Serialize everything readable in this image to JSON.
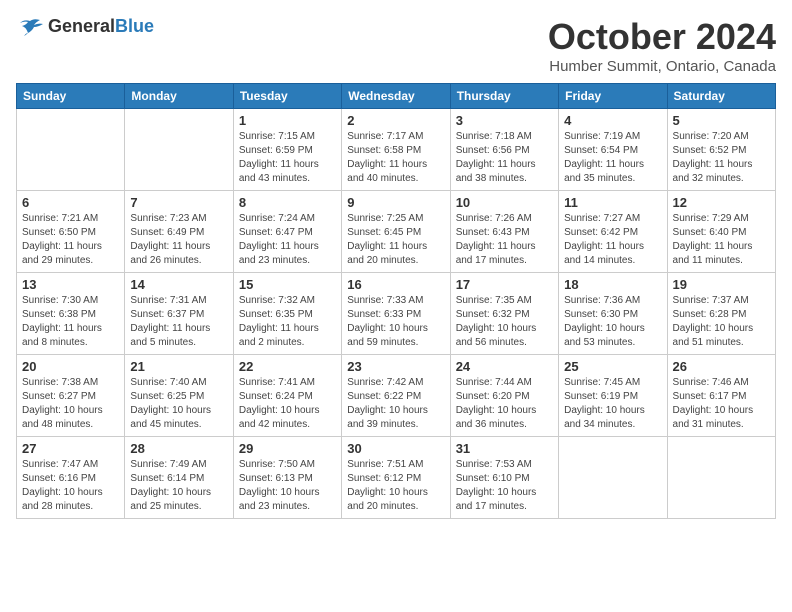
{
  "header": {
    "logo_general": "General",
    "logo_blue": "Blue",
    "month": "October 2024",
    "location": "Humber Summit, Ontario, Canada"
  },
  "weekdays": [
    "Sunday",
    "Monday",
    "Tuesday",
    "Wednesday",
    "Thursday",
    "Friday",
    "Saturday"
  ],
  "weeks": [
    [
      {
        "day": "",
        "sunrise": "",
        "sunset": "",
        "daylight": ""
      },
      {
        "day": "",
        "sunrise": "",
        "sunset": "",
        "daylight": ""
      },
      {
        "day": "1",
        "sunrise": "Sunrise: 7:15 AM",
        "sunset": "Sunset: 6:59 PM",
        "daylight": "Daylight: 11 hours and 43 minutes."
      },
      {
        "day": "2",
        "sunrise": "Sunrise: 7:17 AM",
        "sunset": "Sunset: 6:58 PM",
        "daylight": "Daylight: 11 hours and 40 minutes."
      },
      {
        "day": "3",
        "sunrise": "Sunrise: 7:18 AM",
        "sunset": "Sunset: 6:56 PM",
        "daylight": "Daylight: 11 hours and 38 minutes."
      },
      {
        "day": "4",
        "sunrise": "Sunrise: 7:19 AM",
        "sunset": "Sunset: 6:54 PM",
        "daylight": "Daylight: 11 hours and 35 minutes."
      },
      {
        "day": "5",
        "sunrise": "Sunrise: 7:20 AM",
        "sunset": "Sunset: 6:52 PM",
        "daylight": "Daylight: 11 hours and 32 minutes."
      }
    ],
    [
      {
        "day": "6",
        "sunrise": "Sunrise: 7:21 AM",
        "sunset": "Sunset: 6:50 PM",
        "daylight": "Daylight: 11 hours and 29 minutes."
      },
      {
        "day": "7",
        "sunrise": "Sunrise: 7:23 AM",
        "sunset": "Sunset: 6:49 PM",
        "daylight": "Daylight: 11 hours and 26 minutes."
      },
      {
        "day": "8",
        "sunrise": "Sunrise: 7:24 AM",
        "sunset": "Sunset: 6:47 PM",
        "daylight": "Daylight: 11 hours and 23 minutes."
      },
      {
        "day": "9",
        "sunrise": "Sunrise: 7:25 AM",
        "sunset": "Sunset: 6:45 PM",
        "daylight": "Daylight: 11 hours and 20 minutes."
      },
      {
        "day": "10",
        "sunrise": "Sunrise: 7:26 AM",
        "sunset": "Sunset: 6:43 PM",
        "daylight": "Daylight: 11 hours and 17 minutes."
      },
      {
        "day": "11",
        "sunrise": "Sunrise: 7:27 AM",
        "sunset": "Sunset: 6:42 PM",
        "daylight": "Daylight: 11 hours and 14 minutes."
      },
      {
        "day": "12",
        "sunrise": "Sunrise: 7:29 AM",
        "sunset": "Sunset: 6:40 PM",
        "daylight": "Daylight: 11 hours and 11 minutes."
      }
    ],
    [
      {
        "day": "13",
        "sunrise": "Sunrise: 7:30 AM",
        "sunset": "Sunset: 6:38 PM",
        "daylight": "Daylight: 11 hours and 8 minutes."
      },
      {
        "day": "14",
        "sunrise": "Sunrise: 7:31 AM",
        "sunset": "Sunset: 6:37 PM",
        "daylight": "Daylight: 11 hours and 5 minutes."
      },
      {
        "day": "15",
        "sunrise": "Sunrise: 7:32 AM",
        "sunset": "Sunset: 6:35 PM",
        "daylight": "Daylight: 11 hours and 2 minutes."
      },
      {
        "day": "16",
        "sunrise": "Sunrise: 7:33 AM",
        "sunset": "Sunset: 6:33 PM",
        "daylight": "Daylight: 10 hours and 59 minutes."
      },
      {
        "day": "17",
        "sunrise": "Sunrise: 7:35 AM",
        "sunset": "Sunset: 6:32 PM",
        "daylight": "Daylight: 10 hours and 56 minutes."
      },
      {
        "day": "18",
        "sunrise": "Sunrise: 7:36 AM",
        "sunset": "Sunset: 6:30 PM",
        "daylight": "Daylight: 10 hours and 53 minutes."
      },
      {
        "day": "19",
        "sunrise": "Sunrise: 7:37 AM",
        "sunset": "Sunset: 6:28 PM",
        "daylight": "Daylight: 10 hours and 51 minutes."
      }
    ],
    [
      {
        "day": "20",
        "sunrise": "Sunrise: 7:38 AM",
        "sunset": "Sunset: 6:27 PM",
        "daylight": "Daylight: 10 hours and 48 minutes."
      },
      {
        "day": "21",
        "sunrise": "Sunrise: 7:40 AM",
        "sunset": "Sunset: 6:25 PM",
        "daylight": "Daylight: 10 hours and 45 minutes."
      },
      {
        "day": "22",
        "sunrise": "Sunrise: 7:41 AM",
        "sunset": "Sunset: 6:24 PM",
        "daylight": "Daylight: 10 hours and 42 minutes."
      },
      {
        "day": "23",
        "sunrise": "Sunrise: 7:42 AM",
        "sunset": "Sunset: 6:22 PM",
        "daylight": "Daylight: 10 hours and 39 minutes."
      },
      {
        "day": "24",
        "sunrise": "Sunrise: 7:44 AM",
        "sunset": "Sunset: 6:20 PM",
        "daylight": "Daylight: 10 hours and 36 minutes."
      },
      {
        "day": "25",
        "sunrise": "Sunrise: 7:45 AM",
        "sunset": "Sunset: 6:19 PM",
        "daylight": "Daylight: 10 hours and 34 minutes."
      },
      {
        "day": "26",
        "sunrise": "Sunrise: 7:46 AM",
        "sunset": "Sunset: 6:17 PM",
        "daylight": "Daylight: 10 hours and 31 minutes."
      }
    ],
    [
      {
        "day": "27",
        "sunrise": "Sunrise: 7:47 AM",
        "sunset": "Sunset: 6:16 PM",
        "daylight": "Daylight: 10 hours and 28 minutes."
      },
      {
        "day": "28",
        "sunrise": "Sunrise: 7:49 AM",
        "sunset": "Sunset: 6:14 PM",
        "daylight": "Daylight: 10 hours and 25 minutes."
      },
      {
        "day": "29",
        "sunrise": "Sunrise: 7:50 AM",
        "sunset": "Sunset: 6:13 PM",
        "daylight": "Daylight: 10 hours and 23 minutes."
      },
      {
        "day": "30",
        "sunrise": "Sunrise: 7:51 AM",
        "sunset": "Sunset: 6:12 PM",
        "daylight": "Daylight: 10 hours and 20 minutes."
      },
      {
        "day": "31",
        "sunrise": "Sunrise: 7:53 AM",
        "sunset": "Sunset: 6:10 PM",
        "daylight": "Daylight: 10 hours and 17 minutes."
      },
      {
        "day": "",
        "sunrise": "",
        "sunset": "",
        "daylight": ""
      },
      {
        "day": "",
        "sunrise": "",
        "sunset": "",
        "daylight": ""
      }
    ]
  ]
}
